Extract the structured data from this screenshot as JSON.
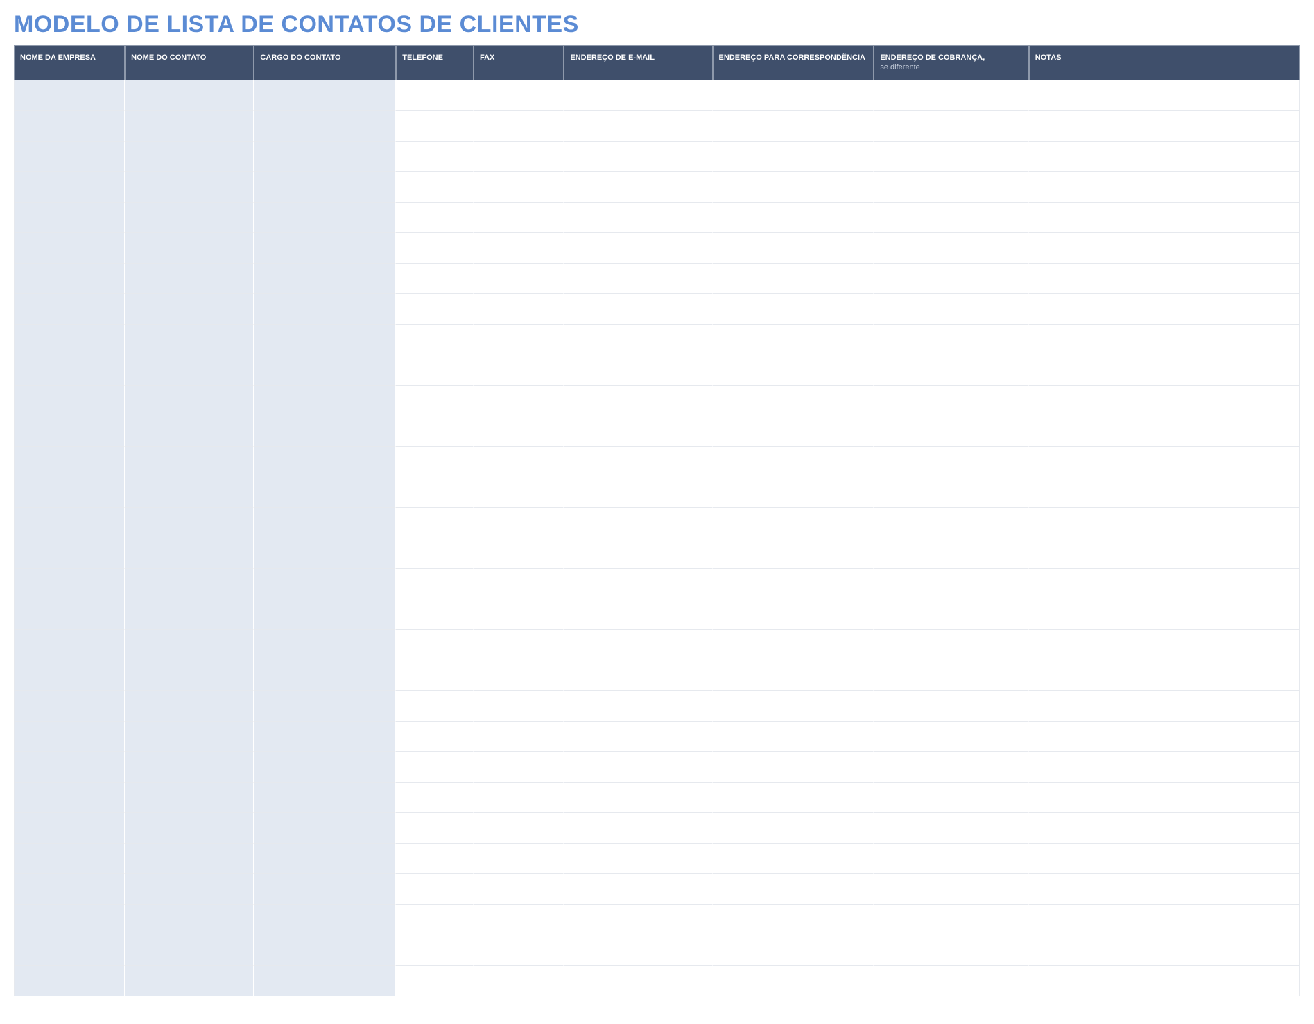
{
  "title": "MODELO DE LISTA DE CONTATOS DE CLIENTES",
  "columns": [
    {
      "label": "NOME DA EMPRESA",
      "sub": "",
      "shaded": true,
      "class": "col-company"
    },
    {
      "label": "NOME DO CONTATO",
      "sub": "",
      "shaded": true,
      "class": "col-contact"
    },
    {
      "label": "CARGO DO CONTATO",
      "sub": "",
      "shaded": true,
      "class": "col-title"
    },
    {
      "label": "TELEFONE",
      "sub": "",
      "shaded": false,
      "class": "col-phone"
    },
    {
      "label": "FAX",
      "sub": "",
      "shaded": false,
      "class": "col-fax"
    },
    {
      "label": "ENDEREÇO DE E-MAIL",
      "sub": "",
      "shaded": false,
      "class": "col-email"
    },
    {
      "label": "ENDEREÇO PARA CORRESPONDÊNCIA",
      "sub": "",
      "shaded": false,
      "class": "col-mailaddr"
    },
    {
      "label": "ENDEREÇO DE COBRANÇA,",
      "sub": "se diferente",
      "shaded": false,
      "class": "col-billaddr"
    },
    {
      "label": "NOTAS",
      "sub": "",
      "shaded": false,
      "class": "col-notes"
    }
  ],
  "row_count": 30,
  "rows": []
}
